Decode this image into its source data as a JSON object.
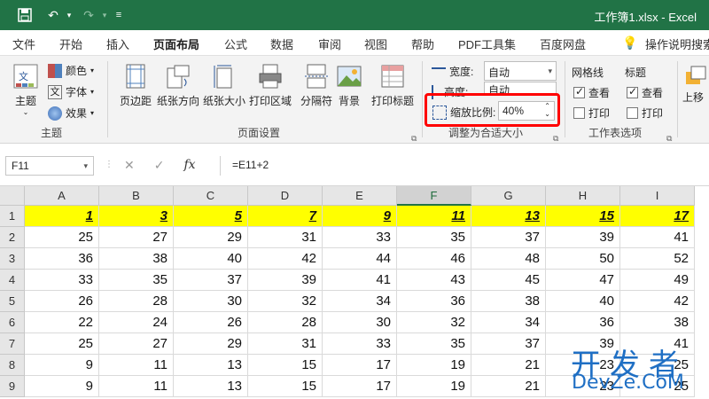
{
  "titlebar": {
    "doc_title": "工作簿1.xlsx  -  Excel",
    "save_icon": "save-icon",
    "undo_icon": "undo-icon",
    "redo_icon": "redo-icon",
    "customize_icon": "customize-quick-access-icon"
  },
  "tabs": [
    "文件",
    "开始",
    "插入",
    "页面布局",
    "公式",
    "数据",
    "审阅",
    "视图",
    "帮助",
    "PDF工具集",
    "百度网盘",
    "操作说明搜索"
  ],
  "active_tab": "页面布局",
  "ribbon": {
    "theme_group": {
      "label": "主题",
      "themes": "主题",
      "colors": "颜色",
      "fonts": "字体",
      "effects": "效果"
    },
    "page_setup": {
      "label": "页面设置",
      "margins": "页边距",
      "orientation": "纸张方向",
      "size": "纸张大小",
      "print_area": "打印区域",
      "breaks": "分隔符",
      "background": "背景",
      "print_titles": "打印标题"
    },
    "scale_to_fit": {
      "label": "调整为合适大小",
      "width_label": "宽度:",
      "width_value": "自动",
      "height_label": "高度:",
      "height_value": "自动",
      "scale_label": "缩放比例:",
      "scale_value": "40%"
    },
    "sheet_options": {
      "label": "工作表选项",
      "gridlines": "网格线",
      "headings": "标题",
      "view": "查看",
      "print": "打印"
    },
    "arrange": {
      "bring_forward": "上移"
    }
  },
  "formula_bar": {
    "name_box": "F11",
    "formula": "=E11+2"
  },
  "sheet": {
    "columns": [
      "A",
      "B",
      "C",
      "D",
      "E",
      "F",
      "G",
      "H",
      "I"
    ],
    "selected_column": "F",
    "rows": [
      {
        "num": "1",
        "cells": [
          "1",
          "3",
          "5",
          "7",
          "9",
          "11",
          "13",
          "15",
          "17"
        ]
      },
      {
        "num": "2",
        "cells": [
          "25",
          "27",
          "29",
          "31",
          "33",
          "35",
          "37",
          "39",
          "41"
        ]
      },
      {
        "num": "3",
        "cells": [
          "36",
          "38",
          "40",
          "42",
          "44",
          "46",
          "48",
          "50",
          "52"
        ]
      },
      {
        "num": "4",
        "cells": [
          "33",
          "35",
          "37",
          "39",
          "41",
          "43",
          "45",
          "47",
          "49"
        ]
      },
      {
        "num": "5",
        "cells": [
          "26",
          "28",
          "30",
          "32",
          "34",
          "36",
          "38",
          "40",
          "42"
        ]
      },
      {
        "num": "6",
        "cells": [
          "22",
          "24",
          "26",
          "28",
          "30",
          "32",
          "34",
          "36",
          "38"
        ]
      },
      {
        "num": "7",
        "cells": [
          "25",
          "27",
          "29",
          "31",
          "33",
          "35",
          "37",
          "39",
          "41"
        ]
      },
      {
        "num": "8",
        "cells": [
          "9",
          "11",
          "13",
          "15",
          "17",
          "19",
          "21",
          "23",
          "25"
        ]
      },
      {
        "num": "9",
        "cells": [
          "9",
          "11",
          "13",
          "15",
          "17",
          "19",
          "21",
          "23",
          "25"
        ]
      }
    ],
    "header_row_fill": "#ffff00"
  },
  "watermark": {
    "line1": "开发者",
    "line2": "DevZe.CoM"
  },
  "colors": {
    "accent": "#217346",
    "highlight_box": "#ff0000"
  }
}
